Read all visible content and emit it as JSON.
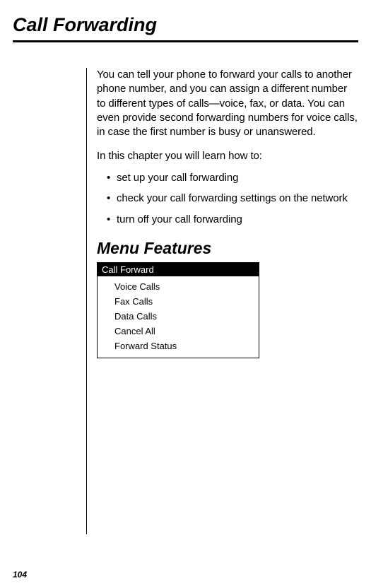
{
  "page": {
    "number": "104"
  },
  "chapter": {
    "title": "Call Forwarding"
  },
  "intro": "You can tell your phone to forward your calls to another phone number, and you can assign a different number to different types of calls—voice, fax, or data. You can even provide second forwarding numbers for voice calls, in case the first number is busy or unanswered.",
  "lead": "In this chapter you will learn how to:",
  "bullets": [
    "set up your call forwarding",
    "check your call forwarding settings on the network",
    "turn off your call forwarding"
  ],
  "section": {
    "heading": "Menu Features"
  },
  "menu": {
    "header": "Call Forward",
    "items": [
      "Voice Calls",
      "Fax Calls",
      "Data Calls",
      "Cancel All",
      "Forward Status"
    ]
  }
}
